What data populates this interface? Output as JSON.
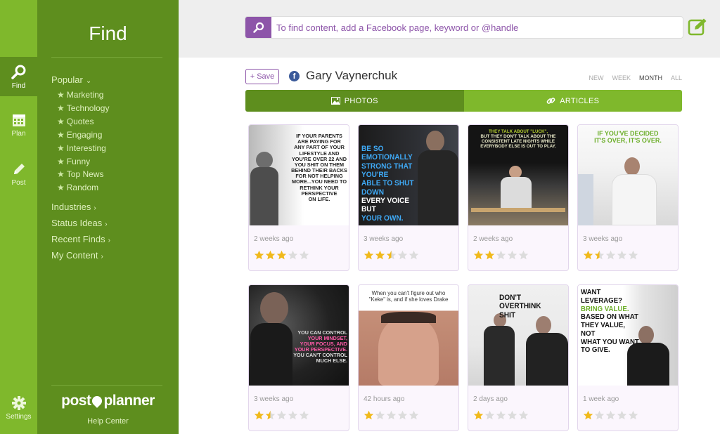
{
  "rail": [
    {
      "label": "Find",
      "icon": "search-icon",
      "active": true
    },
    {
      "label": "Plan",
      "icon": "calendar-icon",
      "active": false
    },
    {
      "label": "Post",
      "icon": "pencil-icon",
      "active": false
    },
    {
      "label": "Settings",
      "icon": "gear-icon",
      "active": false
    }
  ],
  "panel": {
    "title": "Find",
    "popular_label": "Popular",
    "popular_items": [
      "Marketing",
      "Technology",
      "Quotes",
      "Engaging",
      "Interesting",
      "Funny",
      "Top News",
      "Random"
    ],
    "sections": [
      "Industries",
      "Status Ideas",
      "Recent Finds",
      "My Content"
    ],
    "brand_left": "post",
    "brand_right": "planner",
    "help": "Help Center"
  },
  "search": {
    "placeholder": "To find content, add a Facebook page, keyword or @handle"
  },
  "header": {
    "save_label": "+ Save",
    "page_name": "Gary Vaynerchuk",
    "filters": [
      "NEW",
      "WEEK",
      "MONTH",
      "ALL"
    ],
    "active_filter": "MONTH"
  },
  "tabs": {
    "photos": "PHOTOS",
    "articles": "ARTICLES"
  },
  "colors": {
    "rail": "#7fb82c",
    "panel": "#5e8e1e",
    "accent_purple": "#8d55a9",
    "star_on": "#f0b91b",
    "star_off": "#dcdcdc"
  },
  "cards": [
    {
      "time": "2 weeks ago",
      "rating": 3,
      "overlay": [
        "IF YOUR PARENTS",
        "ARE PAYING FOR",
        "ANY PART OF YOUR",
        "LIFESTYLE AND",
        "YOU'RE OVER 22 AND",
        "YOU SHIT ON THEM",
        "BEHIND THEIR BACKS",
        "FOR NOT HELPING",
        "MORE...YOU NEED TO",
        "RETHINK YOUR",
        "PERSPECTIVE",
        "ON LIFE."
      ]
    },
    {
      "time": "3 weeks ago",
      "rating": 2.5,
      "overlay": [
        "BE SO EMOTIONALLY",
        "STRONG THAT YOU'RE",
        "ABLE TO SHUT DOWN",
        "EVERY VOICE BUT",
        "YOUR OWN."
      ]
    },
    {
      "time": "2 weeks ago",
      "rating": 2,
      "overlay": [
        "THEY TALK ABOUT \"LUCK\",",
        "BUT THEY DON'T TALK ABOUT THE",
        "CONSISTENT LATE NIGHTS WHILE",
        "EVERYBODY ELSE IS OUT TO PLAY."
      ]
    },
    {
      "time": "3 weeks ago",
      "rating": 1.5,
      "overlay": [
        "IF YOU'VE DECIDED",
        "IT'S OVER, IT'S OVER."
      ]
    },
    {
      "time": "3 weeks ago",
      "rating": 1.5,
      "overlay": [
        "YOU CAN CONTROL",
        "YOUR MINDSET,",
        "YOUR FOCUS, AND",
        "YOUR PERSPECTIVE.",
        "YOU CAN'T CONTROL",
        "MUCH ELSE."
      ]
    },
    {
      "time": "42 hours ago",
      "rating": 1,
      "overlay": [
        "When you can't figure out who",
        "\"Keke\" is, and if she loves Drake"
      ]
    },
    {
      "time": "2 days ago",
      "rating": 1,
      "overlay": [
        "DON'T",
        "OVERTHINK",
        "SHIT"
      ]
    },
    {
      "time": "1 week ago",
      "rating": 1,
      "overlay": [
        "WANT LEVERAGE?",
        "BRING VALUE.",
        "BASED ON WHAT",
        "THEY VALUE, NOT",
        "WHAT YOU WANT",
        "TO GIVE."
      ]
    }
  ]
}
